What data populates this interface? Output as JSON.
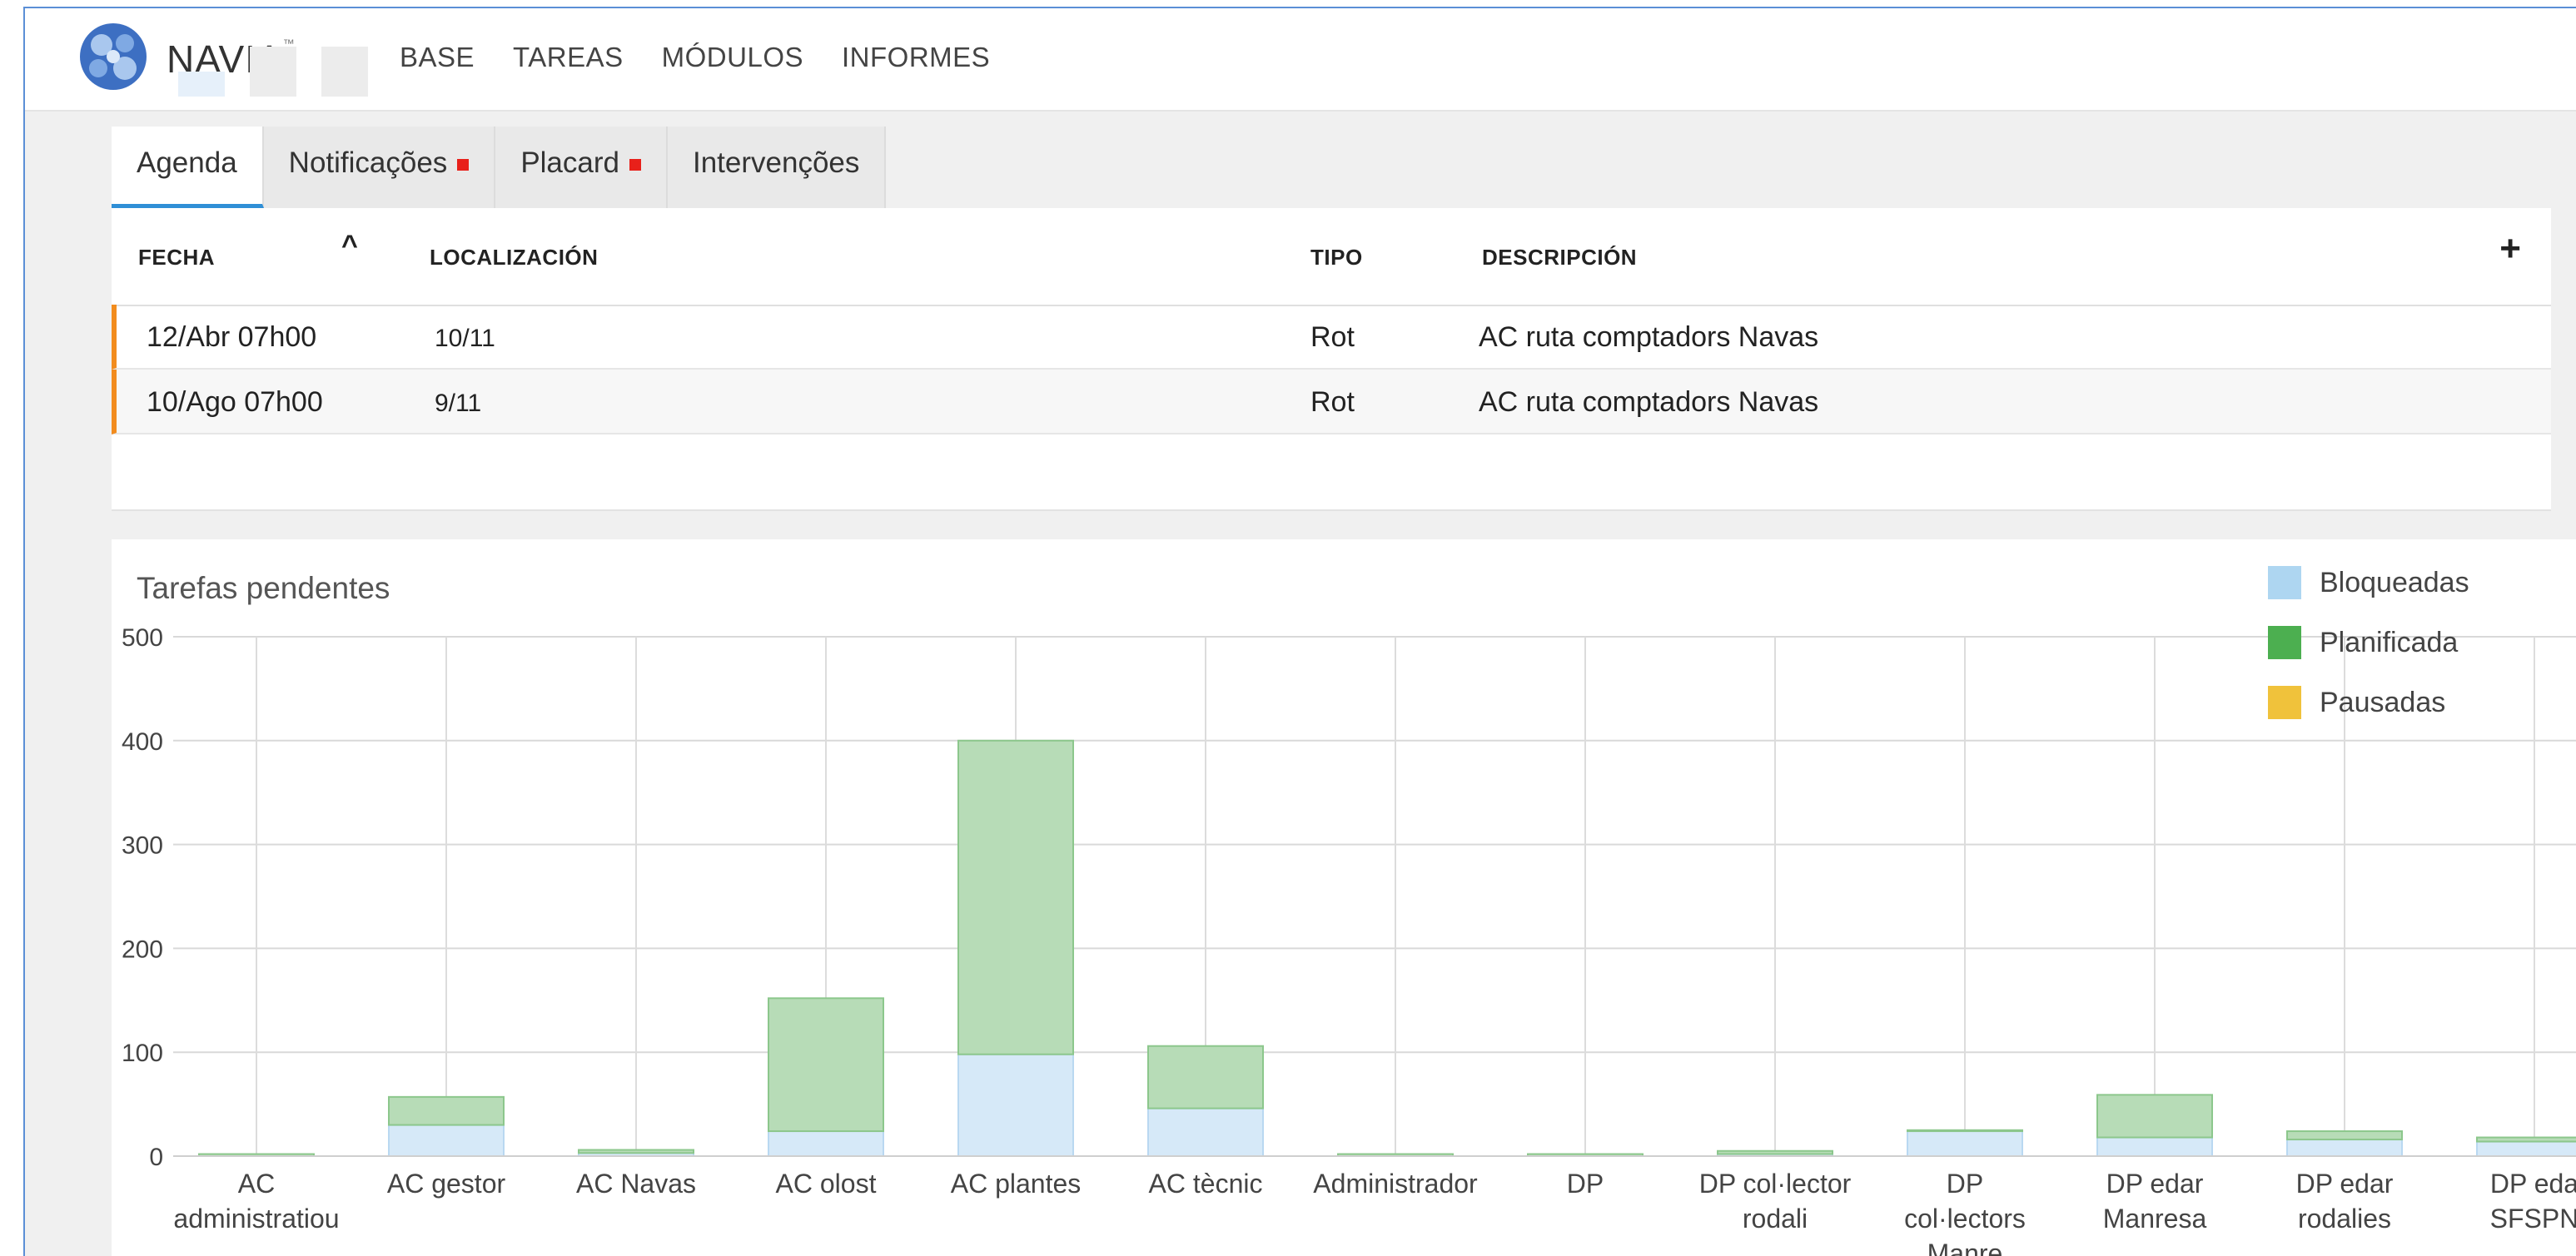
{
  "app": {
    "brand": "NAVIA",
    "brand_mark": "™",
    "nav": [
      "BASE",
      "TAREAS",
      "MÓDULOS",
      "INFORMES"
    ]
  },
  "tabs": [
    {
      "label": "Agenda",
      "active": true,
      "badge": false
    },
    {
      "label": "Notificações",
      "active": false,
      "badge": true
    },
    {
      "label": "Placard",
      "active": false,
      "badge": true
    },
    {
      "label": "Intervenções",
      "active": false,
      "badge": false
    }
  ],
  "agenda": {
    "columns": {
      "fecha": "FECHA",
      "localizacion": "LOCALIZACIÓN",
      "tipo": "TIPO",
      "descripcion": "DESCRIPCIÓN"
    },
    "sort_indicator": "^",
    "add_label": "+",
    "rows": [
      {
        "fecha": "12/Abr 07h00",
        "localizacion": "10/11",
        "tipo": "Rot",
        "descripcion": "AC ruta comptadors Navas"
      },
      {
        "fecha": "10/Ago 07h00",
        "localizacion": "9/11",
        "tipo": "Rot",
        "descripcion": "AC ruta comptadors Navas"
      }
    ]
  },
  "colors": {
    "accent": "#2f8fd6",
    "row_marker": "#f28c1e",
    "badge": "#e8201a"
  },
  "chart_data": {
    "type": "bar",
    "stacked": true,
    "title": "Tarefas pendentes",
    "ylim": [
      0,
      500
    ],
    "yticks": [
      0,
      100,
      200,
      300,
      400,
      500
    ],
    "grid": true,
    "legend_position": "top-right",
    "categories": [
      [
        "AC",
        "administratiou"
      ],
      [
        "AC gestor"
      ],
      [
        "AC Navas"
      ],
      [
        "AC olost"
      ],
      [
        "AC plantes"
      ],
      [
        "AC tècnic"
      ],
      [
        "Administrador"
      ],
      [
        "DP"
      ],
      [
        "DP col·lector",
        "rodali"
      ],
      [
        "DP",
        "col·lectors",
        "Manre"
      ],
      [
        "DP edar",
        "Manresa"
      ],
      [
        "DP edar",
        "rodalies"
      ],
      [
        "DP eda",
        "SFSPN"
      ]
    ],
    "series": [
      {
        "name": "Bloqueadas",
        "color": "#aed6f1",
        "values": [
          0,
          30,
          3,
          24,
          98,
          46,
          0,
          0,
          2,
          24,
          18,
          16,
          14
        ]
      },
      {
        "name": "Planificada",
        "color": "#4caf50",
        "values": [
          2,
          27,
          3,
          128,
          302,
          60,
          2,
          2,
          3,
          1,
          41,
          8,
          4
        ]
      },
      {
        "name": "Pausadas",
        "color": "#f0c23b",
        "values": [
          0,
          0,
          0,
          0,
          0,
          0,
          0,
          0,
          0,
          0,
          0,
          0,
          0
        ]
      }
    ]
  }
}
